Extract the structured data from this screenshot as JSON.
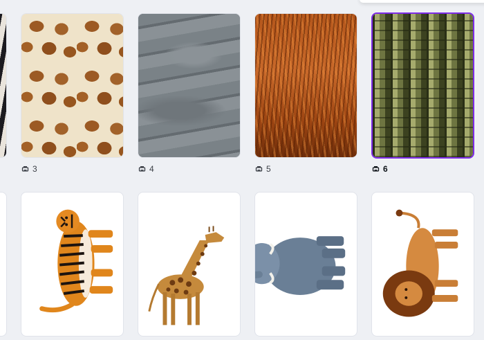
{
  "accent_color": "#7d2ae8",
  "pages": [
    {
      "id": "page-2",
      "number": "",
      "thumb": "zebra-texture",
      "selected": false
    },
    {
      "id": "page-3",
      "number": "3",
      "thumb": "giraffe-texture",
      "selected": false
    },
    {
      "id": "page-4",
      "number": "4",
      "thumb": "rhino-skin-texture",
      "selected": false
    },
    {
      "id": "page-5",
      "number": "5",
      "thumb": "lion-mane-texture",
      "selected": false
    },
    {
      "id": "page-6",
      "number": "6",
      "thumb": "crocodile-skin-texture",
      "selected": true
    }
  ],
  "illustrations": [
    {
      "name": "partial-card",
      "selected": false
    },
    {
      "name": "tiger-illustration",
      "selected": false
    },
    {
      "name": "giraffe-illustration",
      "selected": false
    },
    {
      "name": "elephant-illustration",
      "selected": false
    },
    {
      "name": "lion-illustration",
      "selected": false
    }
  ],
  "icons": {
    "page_icon": "page-stack-icon"
  }
}
